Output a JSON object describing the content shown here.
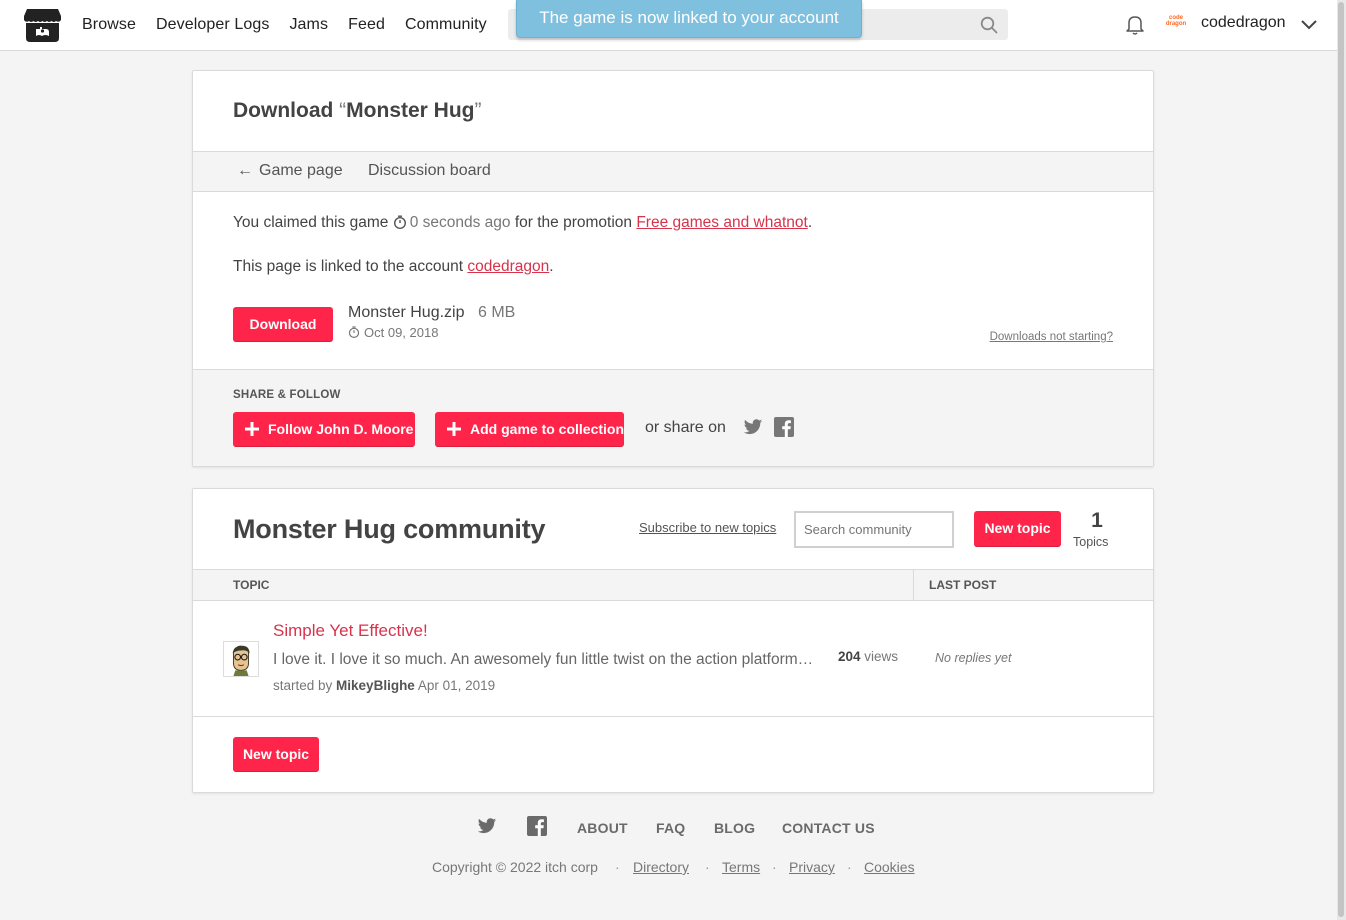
{
  "header": {
    "nav": [
      "Browse",
      "Developer Logs",
      "Jams",
      "Feed",
      "Community"
    ],
    "toast": "The game is now linked to your account",
    "avatar_text": "code dragon",
    "username": "codedragon"
  },
  "download": {
    "title_prefix": "Download ",
    "open_quote": "“",
    "game_name": "Monster Hug",
    "close_quote": "”",
    "tab_back": "Game page",
    "tab_discussion": "Discussion board",
    "claim_pre": "You claimed this game",
    "claim_time": "0 seconds ago",
    "claim_mid": "for the promotion",
    "promo_link": "Free games and whatnot",
    "linked_pre": "This page is linked to the account",
    "linked_account": "codedragon",
    "download_button": "Download",
    "file_name": "Monster Hug.zip",
    "file_size": "6 MB",
    "file_date": "Oct 09, 2018",
    "help_link": "Downloads not starting?",
    "share_label": "SHARE & FOLLOW",
    "follow_button": "Follow John D. Moore",
    "collection_button": "Add game to collection",
    "share_on": "or share on"
  },
  "community": {
    "title": "Monster Hug community",
    "subscribe": "Subscribe to new topics",
    "search_placeholder": "Search community",
    "new_topic": "New topic",
    "topic_count": "1",
    "topic_count_label": "Topics",
    "col_topic": "TOPIC",
    "col_last_post": "LAST POST",
    "topics": [
      {
        "title": "Simple Yet Effective!",
        "excerpt": "I love it. I love it so much. An awesomely fun little twist on the action platformer genre.",
        "started_by": "started by",
        "author": "MikeyBlighe",
        "date": "Apr 01, 2019",
        "views": "204",
        "views_label": "views",
        "last_post": "No replies yet"
      }
    ]
  },
  "footer": {
    "links": [
      "ABOUT",
      "FAQ",
      "BLOG",
      "CONTACT US"
    ],
    "copyright": "Copyright © 2022 itch corp",
    "legal": [
      "Directory",
      "Terms",
      "Privacy",
      "Cookies"
    ],
    "separator": "·"
  },
  "colors": {
    "accent": "#ff2449",
    "link": "#d7334b",
    "toast": "#7ec0de"
  }
}
